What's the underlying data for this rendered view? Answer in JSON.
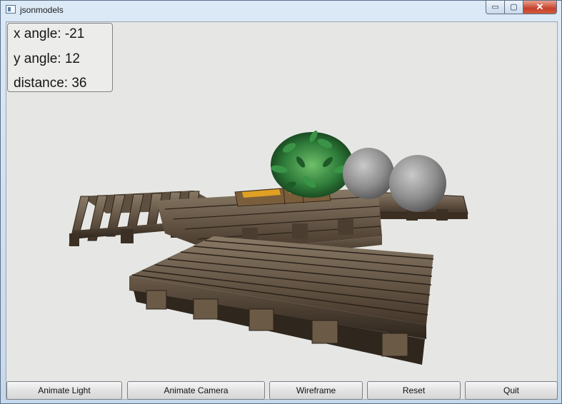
{
  "window": {
    "title": "jsonmodels",
    "controls": {
      "minimize": "▭",
      "maximize": "▢",
      "close": "✕"
    }
  },
  "hud": {
    "x_angle": "x angle: -21",
    "y_angle": "y angle: 12",
    "distance": "distance: 36"
  },
  "scene": {
    "objects": [
      "wooden-pallet",
      "wooden-pallet",
      "wooden-pallet",
      "wooden-pallet",
      "crate-with-oranges",
      "leafy-bush",
      "stone-boulder",
      "stone-boulder"
    ]
  },
  "toolbar": {
    "animate_light": "Animate Light",
    "animate_camera": "Animate Camera",
    "wireframe": "Wireframe",
    "reset": "Reset",
    "quit": "Quit"
  },
  "colors": {
    "background": "#e6e7e4",
    "wood": "#5b4a38",
    "foliage": "#2f7d3a",
    "stone": "#9a9a9a",
    "close_button": "#c6412c"
  }
}
